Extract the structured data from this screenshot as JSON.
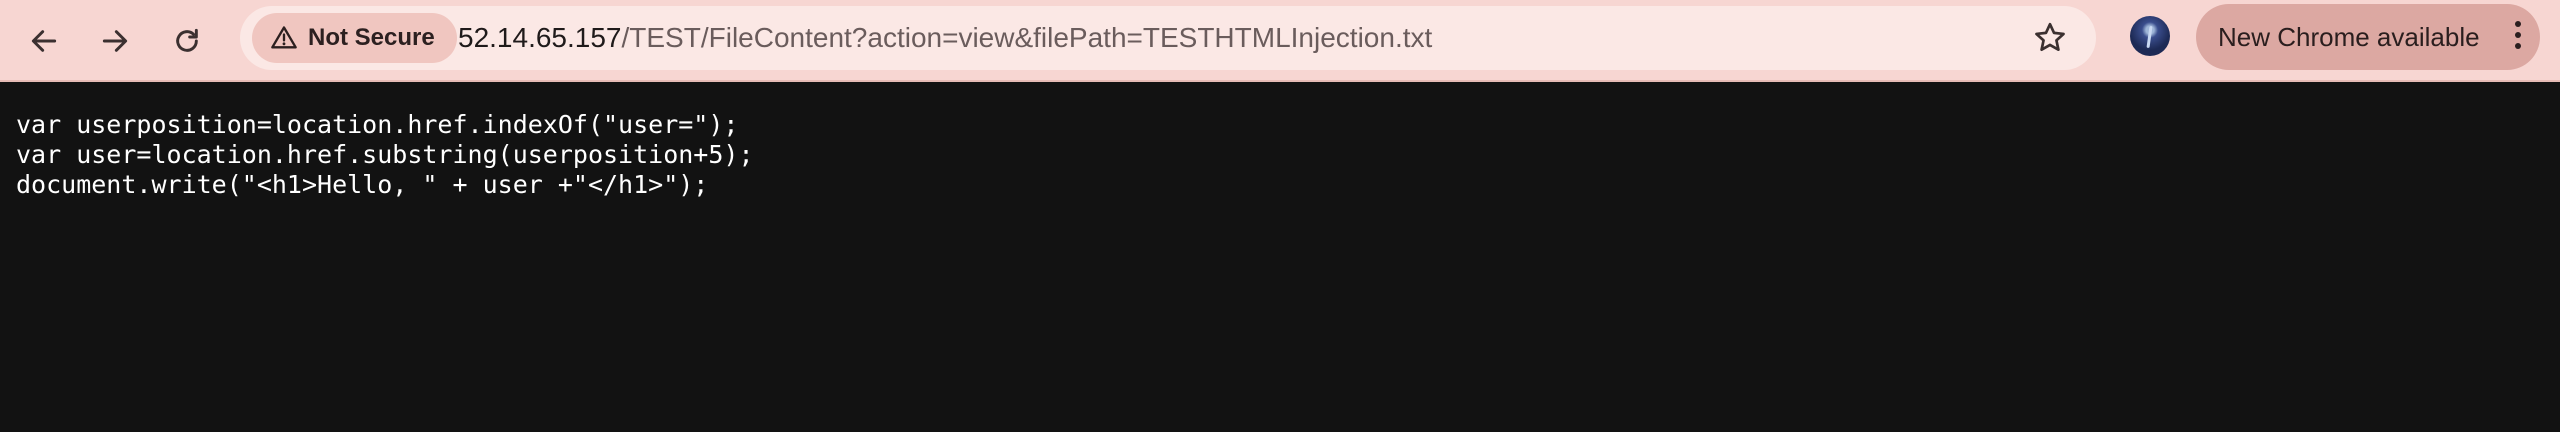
{
  "browser": {
    "security_label": "Not Secure",
    "url_host": "52.14.65.157",
    "url_path": "/TEST/FileContent?action=view&filePath=TESTHTMLInjection.txt",
    "update_label": "New Chrome available",
    "icons": {
      "back": "arrow-left-icon",
      "forward": "arrow-right-icon",
      "reload": "reload-icon",
      "security": "warning-triangle-icon",
      "bookmark": "star-icon",
      "menu": "kebab-menu-icon"
    },
    "colors": {
      "toolbar": "#f7d6d2",
      "omnibox": "#fbe8e5",
      "chip": "#f0c6c0",
      "update_button": "#dca8a2"
    }
  },
  "document": {
    "lines": [
      "var userposition=location.href.indexOf(\"user=\");",
      "var user=location.href.substring(userposition+5);",
      "document.write(\"<h1>Hello, \" + user +\"</h1>\");"
    ],
    "background": "#121212",
    "text_color": "#ffffff"
  }
}
